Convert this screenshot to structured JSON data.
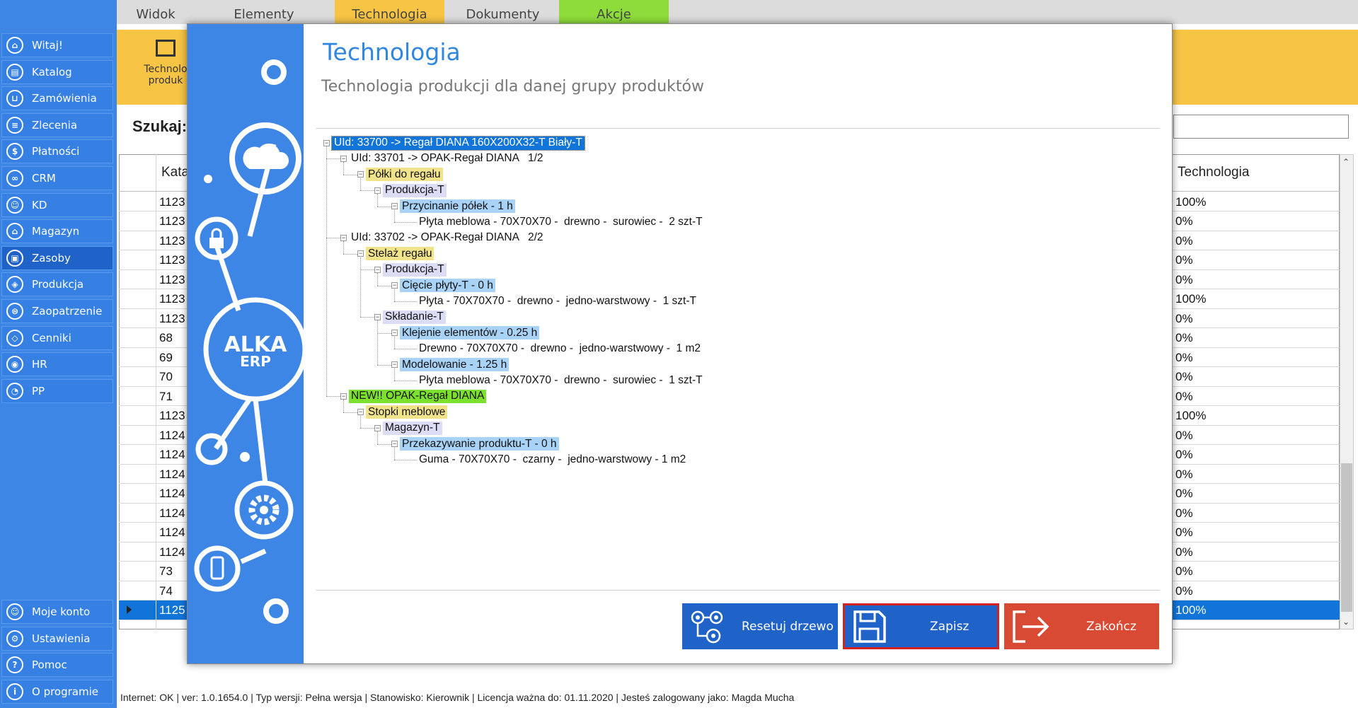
{
  "sidebar": {
    "items": [
      {
        "label": "Witaj!",
        "icon": "home-icon",
        "glyph": "⌂"
      },
      {
        "label": "Katalog",
        "icon": "book-icon",
        "glyph": "▤"
      },
      {
        "label": "Zamówienia",
        "icon": "cart-icon",
        "glyph": "⊔"
      },
      {
        "label": "Zlecenia",
        "icon": "list-icon",
        "glyph": "≡"
      },
      {
        "label": "Płatności",
        "icon": "dollar-icon",
        "glyph": "$"
      },
      {
        "label": "CRM",
        "icon": "crm-icon",
        "glyph": "∞"
      },
      {
        "label": "KD",
        "icon": "person-icon",
        "glyph": "☺"
      },
      {
        "label": "Magazyn",
        "icon": "warehouse-icon",
        "glyph": "⌂"
      },
      {
        "label": "Zasoby",
        "icon": "box-icon",
        "glyph": "▣"
      },
      {
        "label": "Produkcja",
        "icon": "factory-icon",
        "glyph": "◈"
      },
      {
        "label": "Zaopatrzenie",
        "icon": "truck-icon",
        "glyph": "⊜"
      },
      {
        "label": "Cenniki",
        "icon": "tag-icon",
        "glyph": "◇"
      },
      {
        "label": "HR",
        "icon": "id-icon",
        "glyph": "◉"
      },
      {
        "label": "PP",
        "icon": "chart-icon",
        "glyph": "◔"
      }
    ],
    "bottom": [
      {
        "label": "Moje konto",
        "icon": "account-icon",
        "glyph": "☺"
      },
      {
        "label": "Ustawienia",
        "icon": "settings-icon",
        "glyph": "⚙"
      },
      {
        "label": "Pomoc",
        "icon": "help-icon",
        "glyph": "?"
      },
      {
        "label": "O programie",
        "icon": "info-icon",
        "glyph": "i"
      }
    ]
  },
  "tabs": [
    {
      "label": "Widok",
      "bg": "#dcdcdc"
    },
    {
      "label": "Elementy",
      "bg": "#dcdcdc"
    },
    {
      "label": "Technologia",
      "bg": "#f7c444"
    },
    {
      "label": "Dokumenty",
      "bg": "#dcdcdc"
    },
    {
      "label": "Akcje",
      "bg": "#8ddc3a"
    }
  ],
  "ribbon": {
    "button_line1": "Technolo",
    "button_line2": "produk"
  },
  "search": {
    "label": "Szukaj:",
    "value": ""
  },
  "grid": {
    "col_kat": "Kata",
    "col_tech": "Technologia",
    "rows": [
      {
        "kat": "1123",
        "tech": "100%"
      },
      {
        "kat": "1123",
        "tech": "0%"
      },
      {
        "kat": "1123",
        "tech": "0%"
      },
      {
        "kat": "1123",
        "tech": "0%"
      },
      {
        "kat": "1123",
        "tech": "0%"
      },
      {
        "kat": "1123",
        "tech": "100%"
      },
      {
        "kat": "1123",
        "tech": "0%"
      },
      {
        "kat": "68",
        "tech": "0%"
      },
      {
        "kat": "69",
        "tech": "0%"
      },
      {
        "kat": "70",
        "tech": "0%"
      },
      {
        "kat": "71",
        "tech": "0%"
      },
      {
        "kat": "1123",
        "tech": "100%"
      },
      {
        "kat": "1124",
        "tech": "0%"
      },
      {
        "kat": "1124",
        "tech": "0%"
      },
      {
        "kat": "1124",
        "tech": "0%"
      },
      {
        "kat": "1124",
        "tech": "0%"
      },
      {
        "kat": "1124",
        "tech": "0%"
      },
      {
        "kat": "1124",
        "tech": "0%"
      },
      {
        "kat": "1124",
        "tech": "0%"
      },
      {
        "kat": "73",
        "tech": "0%"
      },
      {
        "kat": "74",
        "tech": "0%"
      },
      {
        "kat": "1125",
        "tech": "100%"
      }
    ]
  },
  "status": "Internet: OK  |  ver: 1.0.1654.0  |  Typ wersji: Pełna wersja  |  Stanowisko: Kierownik  |  Licencja ważna do: 01.11.2020  |  Jesteś zalogowany jako: Magda Mucha",
  "modal": {
    "title": "Technologia",
    "subtitle": "Technologia produkcji dla danej grupy produktów",
    "logo_line1": "ALKA",
    "logo_line2": "ERP",
    "tree": [
      {
        "level": 0,
        "text": "UId: 33700 -> Regał DIANA 160X200X32-T Biały-T",
        "hl": "#1074d9",
        "fg": "#ffffff",
        "box": true,
        "sel": true
      },
      {
        "level": 1,
        "text": "UId: 33701 -> OPAK-Regał DIANA   1/2",
        "hl": "",
        "fg": "#111",
        "box": true
      },
      {
        "level": 2,
        "text": "Półki do regału",
        "hl": "#f1e38a",
        "fg": "#111",
        "box": true
      },
      {
        "level": 3,
        "text": "Produkcja-T",
        "hl": "#dcdcf6",
        "fg": "#111",
        "box": true
      },
      {
        "level": 4,
        "text": "Przycinanie półek - 1 h",
        "hl": "#a8d3f7",
        "fg": "#111",
        "box": true
      },
      {
        "level": 5,
        "text": "Płyta meblowa - 70X70X70 -  drewno -  surowiec -  2 szt-T",
        "hl": "",
        "fg": "#111",
        "box": false
      },
      {
        "level": 1,
        "text": "UId: 33702 -> OPAK-Regał DIANA   2/2",
        "hl": "",
        "fg": "#111",
        "box": true
      },
      {
        "level": 2,
        "text": "Stelaż regału",
        "hl": "#f1e38a",
        "fg": "#111",
        "box": true
      },
      {
        "level": 3,
        "text": "Produkcja-T",
        "hl": "#dcdcf6",
        "fg": "#111",
        "box": true
      },
      {
        "level": 4,
        "text": "Cięcie płyty-T - 0 h",
        "hl": "#a8d3f7",
        "fg": "#111",
        "box": true
      },
      {
        "level": 5,
        "text": "Płyta - 70X70X70 -  drewno -  jedno-warstwowy -  1 szt-T",
        "hl": "",
        "fg": "#111",
        "box": false
      },
      {
        "level": 3,
        "text": "Składanie-T",
        "hl": "#dcdcf6",
        "fg": "#111",
        "box": true
      },
      {
        "level": 4,
        "text": "Klejenie elementów - 0.25 h",
        "hl": "#a8d3f7",
        "fg": "#111",
        "box": true
      },
      {
        "level": 5,
        "text": "Drewno - 70X70X70 -  drewno -  jedno-warstwowy -  1 m2",
        "hl": "",
        "fg": "#111",
        "box": false
      },
      {
        "level": 4,
        "text": "Modelowanie - 1.25 h",
        "hl": "#a8d3f7",
        "fg": "#111",
        "box": true
      },
      {
        "level": 5,
        "text": "Płyta meblowa - 70X70X70 -  drewno -  surowiec -  1 szt-T",
        "hl": "",
        "fg": "#111",
        "box": false
      },
      {
        "level": 1,
        "text": "NEW!! OPAK-Regał DIANA",
        "hl": "#7be12e",
        "fg": "#111",
        "box": true
      },
      {
        "level": 2,
        "text": "Stopki meblowe",
        "hl": "#f1e38a",
        "fg": "#111",
        "box": true
      },
      {
        "level": 3,
        "text": "Magazyn-T",
        "hl": "#dcdcf6",
        "fg": "#111",
        "box": true
      },
      {
        "level": 4,
        "text": "Przekazywanie produktu-T - 0 h",
        "hl": "#a8d3f7",
        "fg": "#111",
        "box": true
      },
      {
        "level": 5,
        "text": "Guma - 70X70X70 -  czarny -  jedno-warstwowy - 1 m2",
        "hl": "",
        "fg": "#111",
        "box": false
      }
    ],
    "buttons": {
      "reset": "Resetuj drzewo",
      "save": "Zapisz",
      "close": "Zakończ"
    }
  },
  "colors": {
    "accent": "#2f87e0",
    "sidebar": "#3d86e6",
    "save": "#1f62c8",
    "close": "#d94a35"
  }
}
